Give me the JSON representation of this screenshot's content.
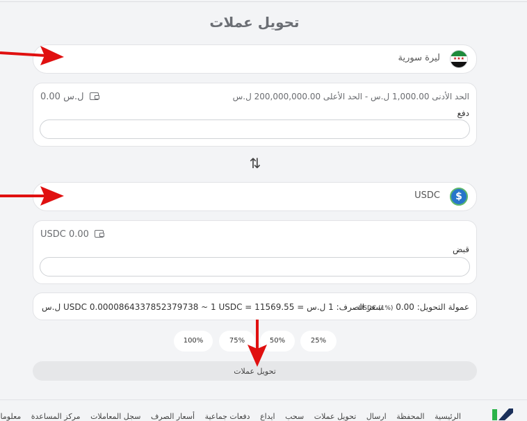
{
  "page": {
    "title": "تحويل عملات"
  },
  "from": {
    "currency_name": "ليرة سورية",
    "flag_icon": "syria-flag-icon",
    "limits_text": "الحد الأدنى 1,000.00 ل.س   -   الحد الأعلى 200,000,000.00 ل.س",
    "balance": "0.00 ل.س",
    "field_label": "دفع",
    "input_value": ""
  },
  "to": {
    "currency_name": "USDC",
    "currency_icon": "usdc-icon",
    "balance": "USDC 0.00",
    "field_label": "قبض",
    "input_value": ""
  },
  "info": {
    "fee_label": "عمولة التحويل:",
    "fee_value": "0.00",
    "fee_detail": "USDC (1%)",
    "rate_text": "سعر الصرف: 1 ل.س = USDC 0.0000864337852379738 ~ 1 USDC = 11569.55 ل.س"
  },
  "percentages": [
    "100%",
    "75%",
    "50%",
    "25%"
  ],
  "submit_label": "تحويل عملات",
  "footer": {
    "nav": [
      "الرئيسية",
      "المحفظة",
      "ارسال",
      "تحويل عملات",
      "سحب",
      "ايداع",
      "دفعات جماعية",
      "أسعار الصرف",
      "سجل المعاملات",
      "مركز المساعدة",
      "معلومات"
    ]
  },
  "colors": {
    "annotation_arrow": "#e01010",
    "usdc": "#2775ca",
    "logo_green": "#2bb34a",
    "logo_navy": "#1a2f5a"
  }
}
